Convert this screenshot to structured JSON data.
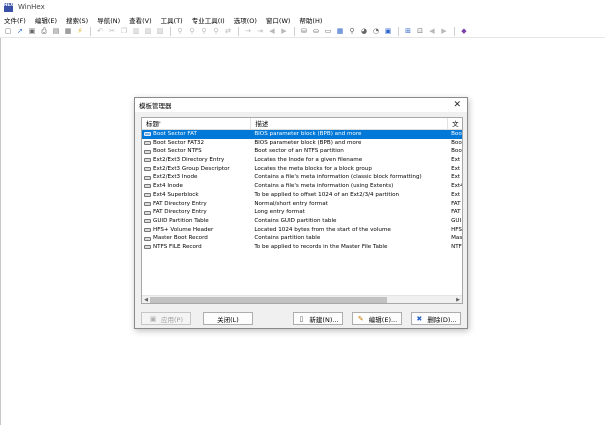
{
  "app": {
    "title": "WinHex",
    "logo_text": "HEX"
  },
  "menu": [
    "文件(F)",
    "编辑(E)",
    "搜索(S)",
    "导航(N)",
    "查看(V)",
    "工具(T)",
    "专业工具(I)",
    "选项(O)",
    "窗口(W)",
    "帮助(H)"
  ],
  "dialog": {
    "title": "模板管理器",
    "close_glyph": "✕",
    "columns": [
      "标题'",
      "描述",
      "文"
    ],
    "rows": [
      {
        "title": "Boot Sector FAT",
        "desc": "BIOS parameter block (BPB) and more",
        "extra": "Boot",
        "selected": true
      },
      {
        "title": "Boot Sector FAT32",
        "desc": "BIOS parameter block (BPB) and more",
        "extra": "Boot"
      },
      {
        "title": "Boot Sector NTFS",
        "desc": "Boot sector of an NTFS partition",
        "extra": "Boot"
      },
      {
        "title": "Ext2/Ext3 Directory Entry",
        "desc": "Locates the Inode for a given filename",
        "extra": "Ext"
      },
      {
        "title": "Ext2/Ext3 Group Descriptor",
        "desc": "Locates the meta blocks for a block group",
        "extra": "Ext"
      },
      {
        "title": "Ext2/Ext3 Inode",
        "desc": "Contains a file's meta information (classic block formatting)",
        "extra": "Ext"
      },
      {
        "title": "Ext4 Inode",
        "desc": "Contains a file's meta information (using Extents)",
        "extra": "Ext4"
      },
      {
        "title": "Ext4 Superblock",
        "desc": "To be applied to offset 1024 of an Ext2/3/4 partition",
        "extra": "Ext"
      },
      {
        "title": "FAT Directory Entry",
        "desc": "Normal/short entry format",
        "extra": "FAT"
      },
      {
        "title": "FAT Directory Entry",
        "desc": "Long entry format",
        "extra": "FAT"
      },
      {
        "title": "GUID Partition Table",
        "desc": "Contains GUID partition table",
        "extra": "GUI"
      },
      {
        "title": "HFS+ Volume Header",
        "desc": "Located 1024 bytes from the start of the volume",
        "extra": "HFS"
      },
      {
        "title": "Master Boot Record",
        "desc": "Contains partition table",
        "extra": "Mas"
      },
      {
        "title": "NTFS FILE Record",
        "desc": "To be applied to records in the Master File Table",
        "extra": "NTF"
      }
    ],
    "scrollbar": {
      "left_arrow": "◀",
      "right_arrow": "▶",
      "thumb_fraction": 0.78
    },
    "buttons": {
      "apply": "应用(P)",
      "close": "关闭(L)",
      "new": "新建(N)...",
      "edit": "编辑(E)...",
      "delete": "删除(D)..."
    }
  }
}
